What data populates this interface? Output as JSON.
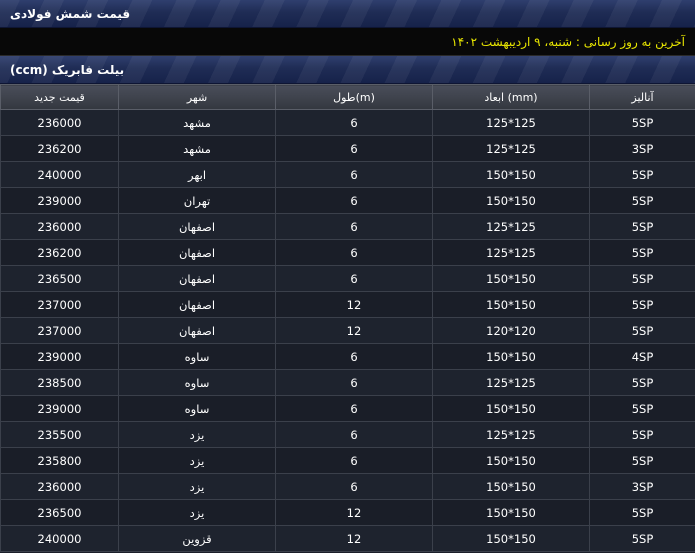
{
  "header": {
    "title": "قیمت شمش فولادی"
  },
  "update": {
    "text": "آخرین به روز رسانی : شنبه، ۹ اردیبهشت ۱۴۰۲"
  },
  "section": {
    "title": "بیلت فابریک (ccm)"
  },
  "table": {
    "columns": [
      "قیمت جدید",
      "شهر",
      "طول(m)",
      "ابعاد (mm)",
      "آنالیز"
    ],
    "rows": [
      [
        "236000",
        "مشهد",
        "6",
        "125*125",
        "5SP"
      ],
      [
        "236200",
        "مشهد",
        "6",
        "125*125",
        "3SP"
      ],
      [
        "240000",
        "ابهر",
        "6",
        "150*150",
        "5SP"
      ],
      [
        "239000",
        "تهران",
        "6",
        "150*150",
        "5SP"
      ],
      [
        "236000",
        "اصفهان",
        "6",
        "125*125",
        "5SP"
      ],
      [
        "236200",
        "اصفهان",
        "6",
        "125*125",
        "5SP"
      ],
      [
        "236500",
        "اصفهان",
        "6",
        "150*150",
        "5SP"
      ],
      [
        "237000",
        "اصفهان",
        "12",
        "150*150",
        "5SP"
      ],
      [
        "237000",
        "اصفهان",
        "12",
        "120*120",
        "5SP"
      ],
      [
        "239000",
        "ساوه",
        "6",
        "150*150",
        "4SP"
      ],
      [
        "238500",
        "ساوه",
        "6",
        "125*125",
        "5SP"
      ],
      [
        "239000",
        "ساوه",
        "6",
        "150*150",
        "5SP"
      ],
      [
        "235500",
        "یزد",
        "6",
        "125*125",
        "5SP"
      ],
      [
        "235800",
        "یزد",
        "6",
        "150*150",
        "5SP"
      ],
      [
        "236000",
        "یزد",
        "6",
        "150*150",
        "3SP"
      ],
      [
        "236500",
        "یزد",
        "12",
        "150*150",
        "5SP"
      ],
      [
        "240000",
        "قزوین",
        "12",
        "150*150",
        "5SP"
      ]
    ]
  }
}
